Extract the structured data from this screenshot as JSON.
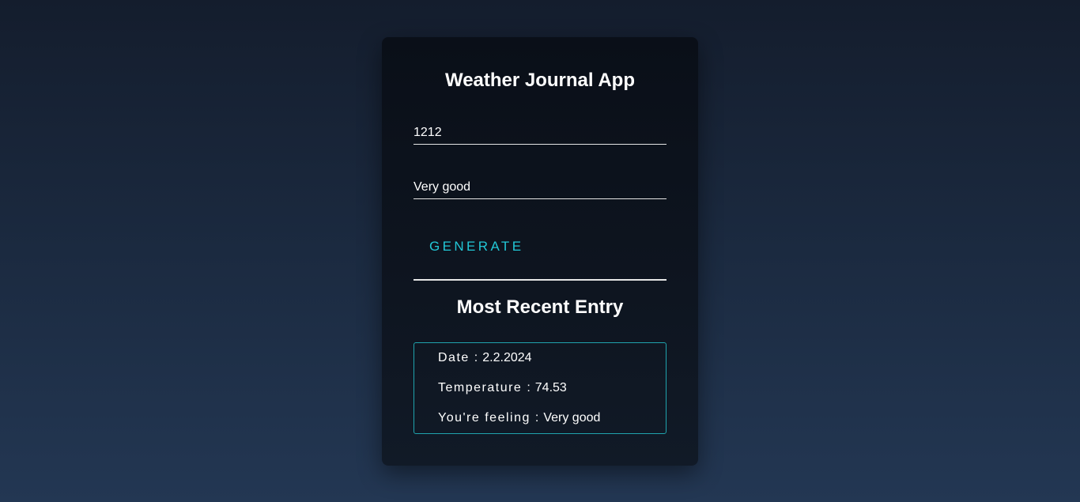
{
  "app": {
    "title": "Weather Journal App"
  },
  "form": {
    "zip_value": "1212",
    "feelings_value": "Very good",
    "generate_label": "GENERATE"
  },
  "recent": {
    "heading": "Most Recent Entry",
    "separator": ":",
    "date_label": "Date",
    "date_value": "2.2.2024",
    "temp_label": "Temperature",
    "temp_value": "74.53",
    "feeling_label": "You're feeling",
    "feeling_value": "Very good"
  },
  "colors": {
    "accent": "#22c7d6",
    "entry_border": "#1fa3ad",
    "card_bg": "#0c121c"
  }
}
